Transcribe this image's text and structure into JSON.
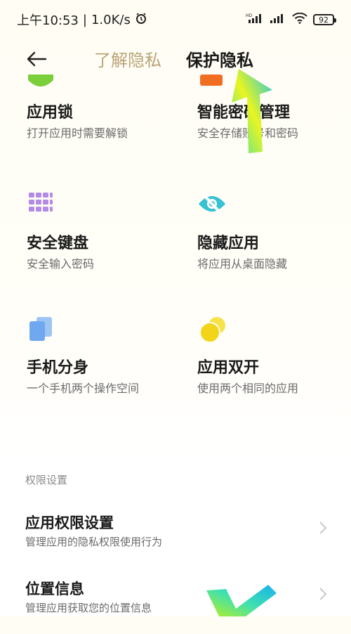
{
  "status": {
    "time": "上午10:53",
    "speed": "1.0K/s",
    "battery": "92"
  },
  "header": {
    "tabs": [
      {
        "label": "了解隐私",
        "active": false
      },
      {
        "label": "保护隐私",
        "active": true
      }
    ]
  },
  "features": [
    {
      "title": "应用锁",
      "desc": "打开应用时需要解锁",
      "icon": "app-lock-icon",
      "color": "#7bcf3a"
    },
    {
      "title": "智能密码管理",
      "desc": "安全存储账号和密码",
      "icon": "password-manager-icon",
      "color": "#f06d22"
    },
    {
      "title": "安全键盘",
      "desc": "安全输入密码",
      "icon": "keyboard-icon",
      "color": "#b38ae6"
    },
    {
      "title": "隐藏应用",
      "desc": "将应用从桌面隐藏",
      "icon": "hide-eye-icon",
      "color": "#36c2d2"
    },
    {
      "title": "手机分身",
      "desc": "一个手机两个操作空间",
      "icon": "second-space-icon",
      "color": "#6fa8ee"
    },
    {
      "title": "应用双开",
      "desc": "使用两个相同的应用",
      "icon": "dual-apps-icon",
      "color": "#f2d418"
    }
  ],
  "permissions": {
    "section_label": "权限设置",
    "items": [
      {
        "title": "应用权限设置",
        "desc": "管理应用的隐私权限使用行为"
      },
      {
        "title": "位置信息",
        "desc": "管理应用获取您的位置信息"
      }
    ]
  }
}
